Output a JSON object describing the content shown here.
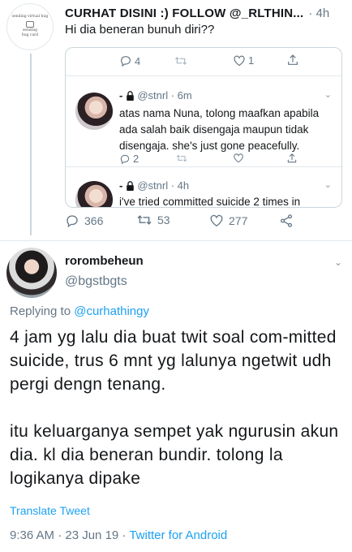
{
  "top_tweet": {
    "display_name": "CURHAT DISINI :) FOLLOW @_RLTHIN...",
    "time": "· 4h",
    "text": "Hi dia beneran bunuh diri??",
    "avatar_lines": [
      "sending virtual hug",
      "sending",
      "hug card"
    ],
    "quote_actions": {
      "replies": "4",
      "likes": "1"
    },
    "quoted_replies": [
      {
        "dash": "-",
        "handle": "@stnrl · 6m",
        "text": "atas nama Nuna, tolong maafkan apabila ada salah baik disengaja maupun tidak disengaja. she's just gone peacefully.",
        "replies": "2"
      },
      {
        "dash": "-",
        "handle": "@stnrl · 4h",
        "text": "i've tried committed suicide 2 times in"
      }
    ],
    "stats": {
      "replies": "366",
      "retweets": "53",
      "likes": "277"
    }
  },
  "main_tweet": {
    "display_name": "rorombeheun",
    "handle": "@bgstbgts",
    "replying_prefix": "Replying to",
    "replying_to": "@curhathingy",
    "paragraphs": [
      "4 jam yg lalu dia buat twit soal com-mitted suicide, trus 6 mnt yg lalunya ngetwit udh pergi dengn tenang.",
      "itu keluarganya sempet yak ngurusin akun dia. kl dia beneran bundir. tolong la logikanya dipake"
    ],
    "translate": "Translate Tweet",
    "meta_time": "9:36 AM · 23 Jun 19 ·",
    "meta_source": "Twitter for Android"
  },
  "colors": {
    "link": "#1da1f2",
    "secondary": "#657786",
    "border": "#e1e8ed"
  }
}
